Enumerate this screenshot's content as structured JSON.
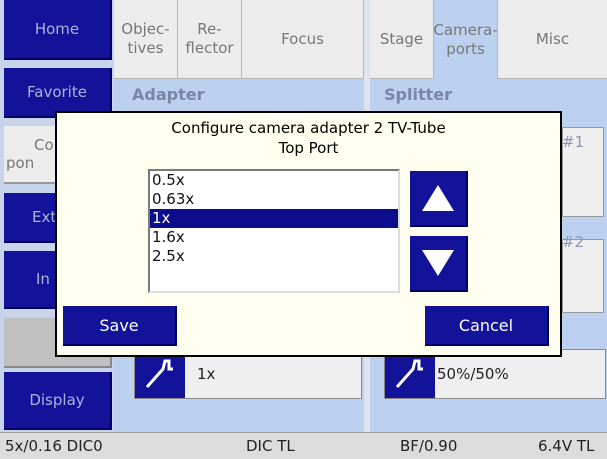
{
  "sidebar": {
    "home": "Home",
    "favorite": "Favorite",
    "components_fragment_1": "Co",
    "components_fragment_2": "pon",
    "ext_fragment": "Ext",
    "in_fragment": "In",
    "display": "Display"
  },
  "tabs": {
    "objectives_line1": "Objec-",
    "objectives_line2": "tives",
    "reflector_line1": "Re-",
    "reflector_line2": "flector",
    "focus": "Focus",
    "stage": "Stage",
    "cameraports_line1": "Camera-",
    "cameraports_line2": "ports",
    "misc": "Misc"
  },
  "left_panel": {
    "title": "Adapter",
    "value": "1x"
  },
  "right_panel": {
    "title": "Splitter",
    "port1_fragment": "#1",
    "port2_fragment": "#2",
    "value": "50%/50%"
  },
  "dialog": {
    "title_line1": "Configure camera adapter 2 TV-Tube",
    "title_line2": "Top Port",
    "options": [
      "0.5x",
      "0.63x",
      "1x",
      "1.6x",
      "2.5x"
    ],
    "selected": "1x",
    "save_label": "Save",
    "cancel_label": "Cancel",
    "up_icon": "arrow-up-icon",
    "down_icon": "arrow-down-icon"
  },
  "status": {
    "objective": "5x/0.16 DIC0",
    "contrast": "DIC TL",
    "illumination": "BF/0.90",
    "voltage": "6.4V TL"
  },
  "colors": {
    "button_blue": "#13139a",
    "panel_blue": "#bcd0f0",
    "dialog_bg": "#fffff0",
    "selection": "#0c0c8c"
  }
}
